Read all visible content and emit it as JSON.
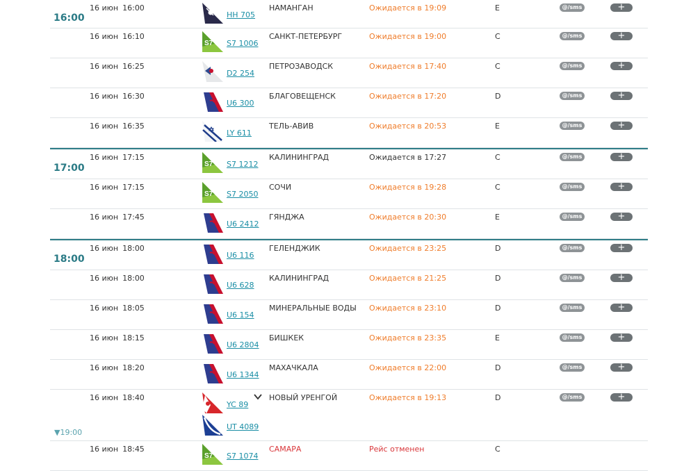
{
  "actions": {
    "sms_label": "@/sms",
    "add_label": "+"
  },
  "groups": [
    {
      "hour": "16:00",
      "rows": [
        {
          "date": "16 июн",
          "time": "16:00",
          "flights": [
            {
              "code": "HH 705",
              "logo": "somon"
            }
          ],
          "destination": "НАМАНГАН",
          "status": "Ожидается в 19:09",
          "status_type": "delayed",
          "terminal": "E",
          "sms": true,
          "add": true
        },
        {
          "date": "16 июн",
          "time": "16:10",
          "flights": [
            {
              "code": "S7 1006",
              "logo": "s7"
            }
          ],
          "destination": "САНКТ-ПЕТЕРБУРГ",
          "status": "Ожидается в 19:00",
          "status_type": "delayed",
          "terminal": "C",
          "sms": true,
          "add": true
        },
        {
          "date": "16 июн",
          "time": "16:25",
          "flights": [
            {
              "code": "D2 254",
              "logo": "severstal"
            }
          ],
          "destination": "ПЕТРОЗАВОДСК",
          "status": "Ожидается в 17:40",
          "status_type": "delayed",
          "terminal": "C",
          "sms": true,
          "add": true
        },
        {
          "date": "16 июн",
          "time": "16:30",
          "flights": [
            {
              "code": "U6 300",
              "logo": "ural"
            }
          ],
          "destination": "БЛАГОВЕЩЕНСК",
          "status": "Ожидается в 17:20",
          "status_type": "delayed",
          "terminal": "D",
          "sms": true,
          "add": true
        },
        {
          "date": "16 июн",
          "time": "16:35",
          "flights": [
            {
              "code": "LY 611",
              "logo": "elal"
            }
          ],
          "destination": "ТЕЛЬ-АВИВ",
          "status": "Ожидается в 20:53",
          "status_type": "delayed",
          "terminal": "E",
          "sms": true,
          "add": true
        }
      ]
    },
    {
      "hour": "17:00",
      "rows": [
        {
          "date": "16 июн",
          "time": "17:15",
          "flights": [
            {
              "code": "S7 1212",
              "logo": "s7"
            }
          ],
          "destination": "КАЛИНИНГРАД",
          "status": "Ожидается в 17:27",
          "status_type": "ontime",
          "terminal": "C",
          "sms": true,
          "add": true
        },
        {
          "date": "16 июн",
          "time": "17:15",
          "flights": [
            {
              "code": "S7 2050",
              "logo": "s7"
            }
          ],
          "destination": "СОЧИ",
          "status": "Ожидается в 19:28",
          "status_type": "delayed",
          "terminal": "C",
          "sms": true,
          "add": true
        },
        {
          "date": "16 июн",
          "time": "17:45",
          "flights": [
            {
              "code": "U6 2412",
              "logo": "ural"
            }
          ],
          "destination": "ГЯНДЖА",
          "status": "Ожидается в 20:30",
          "status_type": "delayed",
          "terminal": "E",
          "sms": true,
          "add": true
        }
      ]
    },
    {
      "hour": "18:00",
      "rows": [
        {
          "date": "16 июн",
          "time": "18:00",
          "flights": [
            {
              "code": "U6 116",
              "logo": "ural"
            }
          ],
          "destination": "ГЕЛЕНДЖИК",
          "status": "Ожидается в 23:25",
          "status_type": "delayed",
          "terminal": "D",
          "sms": true,
          "add": true
        },
        {
          "date": "16 июн",
          "time": "18:00",
          "flights": [
            {
              "code": "U6 628",
              "logo": "ural"
            }
          ],
          "destination": "КАЛИНИНГРАД",
          "status": "Ожидается в 21:25",
          "status_type": "delayed",
          "terminal": "D",
          "sms": true,
          "add": true
        },
        {
          "date": "16 июн",
          "time": "18:05",
          "flights": [
            {
              "code": "U6 154",
              "logo": "ural"
            }
          ],
          "destination": "МИНЕРАЛЬНЫЕ ВОДЫ",
          "status": "Ожидается в 23:10",
          "status_type": "delayed",
          "terminal": "D",
          "sms": true,
          "add": true
        },
        {
          "date": "16 июн",
          "time": "18:15",
          "flights": [
            {
              "code": "U6 2804",
              "logo": "ural"
            }
          ],
          "destination": "БИШКЕК",
          "status": "Ожидается в 23:35",
          "status_type": "delayed",
          "terminal": "E",
          "sms": true,
          "add": true
        },
        {
          "date": "16 июн",
          "time": "18:20",
          "flights": [
            {
              "code": "U6 1344",
              "logo": "ural"
            }
          ],
          "destination": "МАХАЧКАЛА",
          "status": "Ожидается в 22:00",
          "status_type": "delayed",
          "terminal": "D",
          "sms": true,
          "add": true
        },
        {
          "date": "16 июн",
          "time": "18:40",
          "flights": [
            {
              "code": "YC 89",
              "logo": "yamal"
            },
            {
              "code": "UT 4089",
              "logo": "utair"
            }
          ],
          "destination": "НОВЫЙ УРЕНГОЙ",
          "status": "Ожидается в 19:13",
          "status_type": "delayed",
          "terminal": "D",
          "sms": true,
          "add": true,
          "expand": true,
          "next_hour": "▼19:00"
        },
        {
          "date": "16 июн",
          "time": "18:45",
          "flights": [
            {
              "code": "S7 1074",
              "logo": "s7"
            }
          ],
          "destination": "САМАРА",
          "status": "Рейс отменен",
          "status_type": "cancelled",
          "terminal": "C",
          "sms": false,
          "add": false
        }
      ]
    }
  ],
  "colors": {
    "accent": "#2b7b86",
    "delayed": "#ef7c2a",
    "cancelled": "#d9373b",
    "link": "#1a8ea5"
  }
}
